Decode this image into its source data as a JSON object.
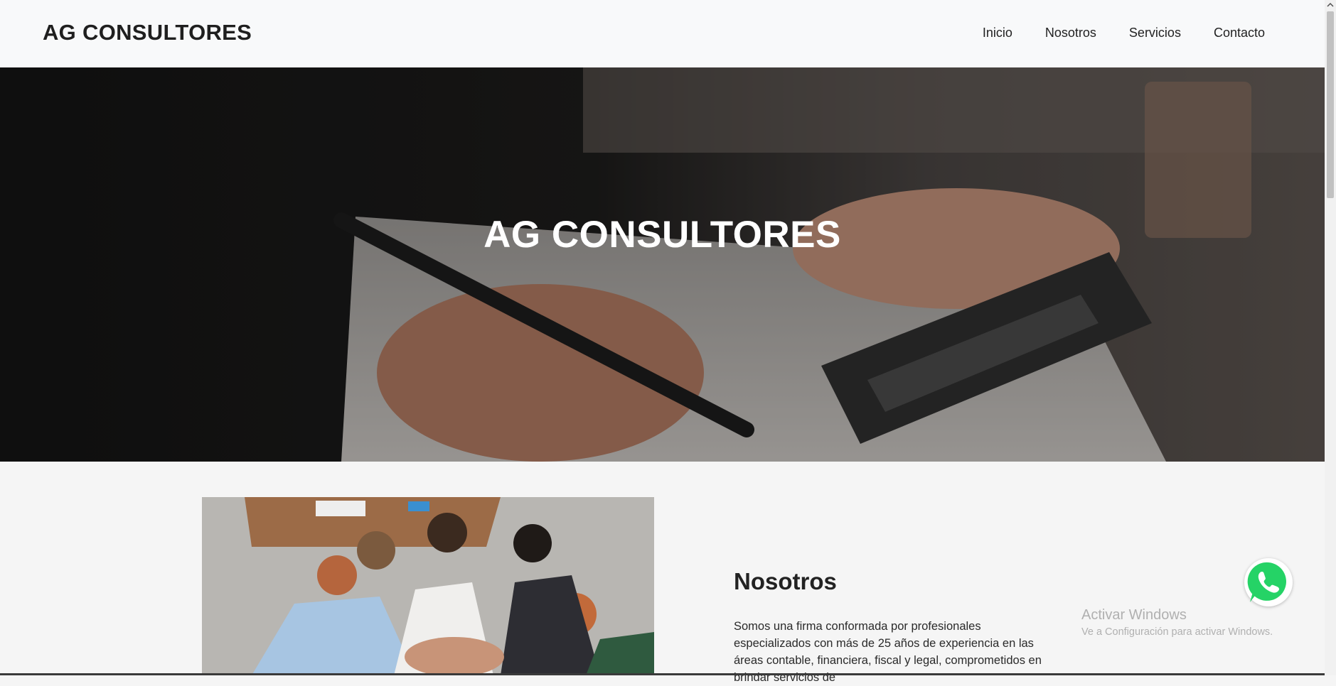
{
  "navbar": {
    "brand": "AG CONSULTORES",
    "links": [
      "Inicio",
      "Nosotros",
      "Servicios",
      "Contacto"
    ]
  },
  "hero": {
    "title": "AG CONSULTORES",
    "image": "hands-writing-with-pen-and-calculator-photo"
  },
  "about": {
    "image": "team-hands-stacked-photo",
    "heading": "Nosotros",
    "text": "Somos una firma conformada por profesionales especializados con más de 25 años de experiencia en las áreas contable, financiera, fiscal y legal, comprometidos en brindar servicios de"
  },
  "watermark": {
    "title": "Activar Windows",
    "subtitle": "Ve a Configuración para activar Windows."
  },
  "whatsapp_button": {
    "icon": "whatsapp-icon"
  },
  "colors": {
    "navbar_bg": "#f8f9fa",
    "page_bg": "#f5f5f5",
    "whatsapp_green": "#25d366",
    "text_dark": "#212529"
  }
}
